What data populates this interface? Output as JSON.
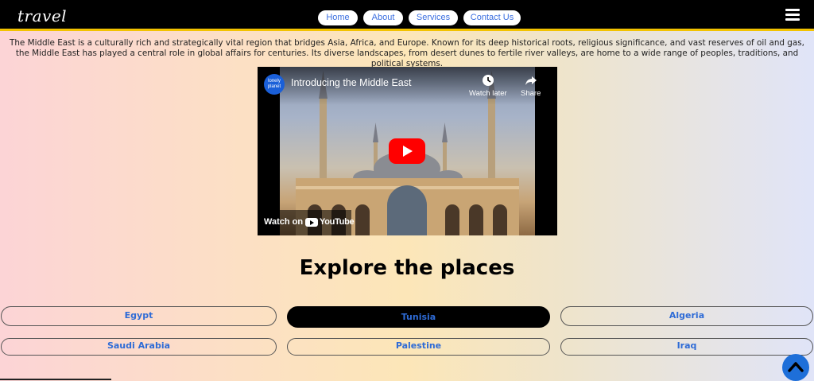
{
  "header": {
    "logo": "travel",
    "nav": [
      {
        "label": "Home"
      },
      {
        "label": "About"
      },
      {
        "label": "Services"
      },
      {
        "label": "Contact Us"
      }
    ]
  },
  "intro_text": "The Middle East is a culturally rich and strategically vital region that bridges Asia, Africa, and Europe. Known for its deep historical roots, religious significance, and vast reserves of oil and gas, the Middle East has played a central role in global affairs for centuries. Its diverse landscapes, from desert dunes to fertile river valleys, are home to a wide range of peoples, traditions, and political systems.",
  "video": {
    "channel": "lonely planet",
    "title": "Introducing the Middle East",
    "watch_later": "Watch later",
    "share": "Share",
    "watch_on": "Watch on",
    "youtube": "YouTube"
  },
  "section_title": "Explore the places",
  "places": [
    {
      "label": "Egypt"
    },
    {
      "label": "Tunisia"
    },
    {
      "label": "Algeria"
    },
    {
      "label": "Saudi Arabia"
    },
    {
      "label": "Palestine"
    },
    {
      "label": "Iraq"
    }
  ],
  "colors": {
    "nav_accent": "#f2c200",
    "link_blue": "#2e6bd6",
    "scroll_button": "#1e6fd9"
  }
}
